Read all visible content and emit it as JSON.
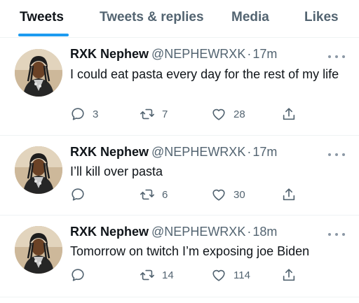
{
  "tabs": [
    {
      "label": "Tweets",
      "active": true
    },
    {
      "label": "Tweets & replies",
      "active": false
    },
    {
      "label": "Media",
      "active": false
    },
    {
      "label": "Likes",
      "active": false
    }
  ],
  "colors": {
    "accent": "#1d9bf0",
    "text": "#0f1419",
    "secondary": "#536471",
    "divider": "#eff3f4"
  },
  "tweets": [
    {
      "name": "RXK Nephew",
      "handle": "@NEPHEWRXK",
      "separator": "·",
      "time": "17m",
      "text": "I could eat pasta every day for the rest of my life",
      "replies": "3",
      "retweets": "7",
      "likes": "28"
    },
    {
      "name": "RXK Nephew",
      "handle": "@NEPHEWRXK",
      "separator": "·",
      "time": "17m",
      "text": "I’ll kill over pasta",
      "replies": "",
      "retweets": "6",
      "likes": "30"
    },
    {
      "name": "RXK Nephew",
      "handle": "@NEPHEWRXK",
      "separator": "·",
      "time": "18m",
      "text": "Tomorrow on twitch I’m exposing joe Biden",
      "replies": "",
      "retweets": "14",
      "likes": "114"
    }
  ],
  "icons": {
    "reply": "reply-icon",
    "retweet": "retweet-icon",
    "like": "heart-icon",
    "share": "share-icon",
    "more": "more-icon"
  }
}
